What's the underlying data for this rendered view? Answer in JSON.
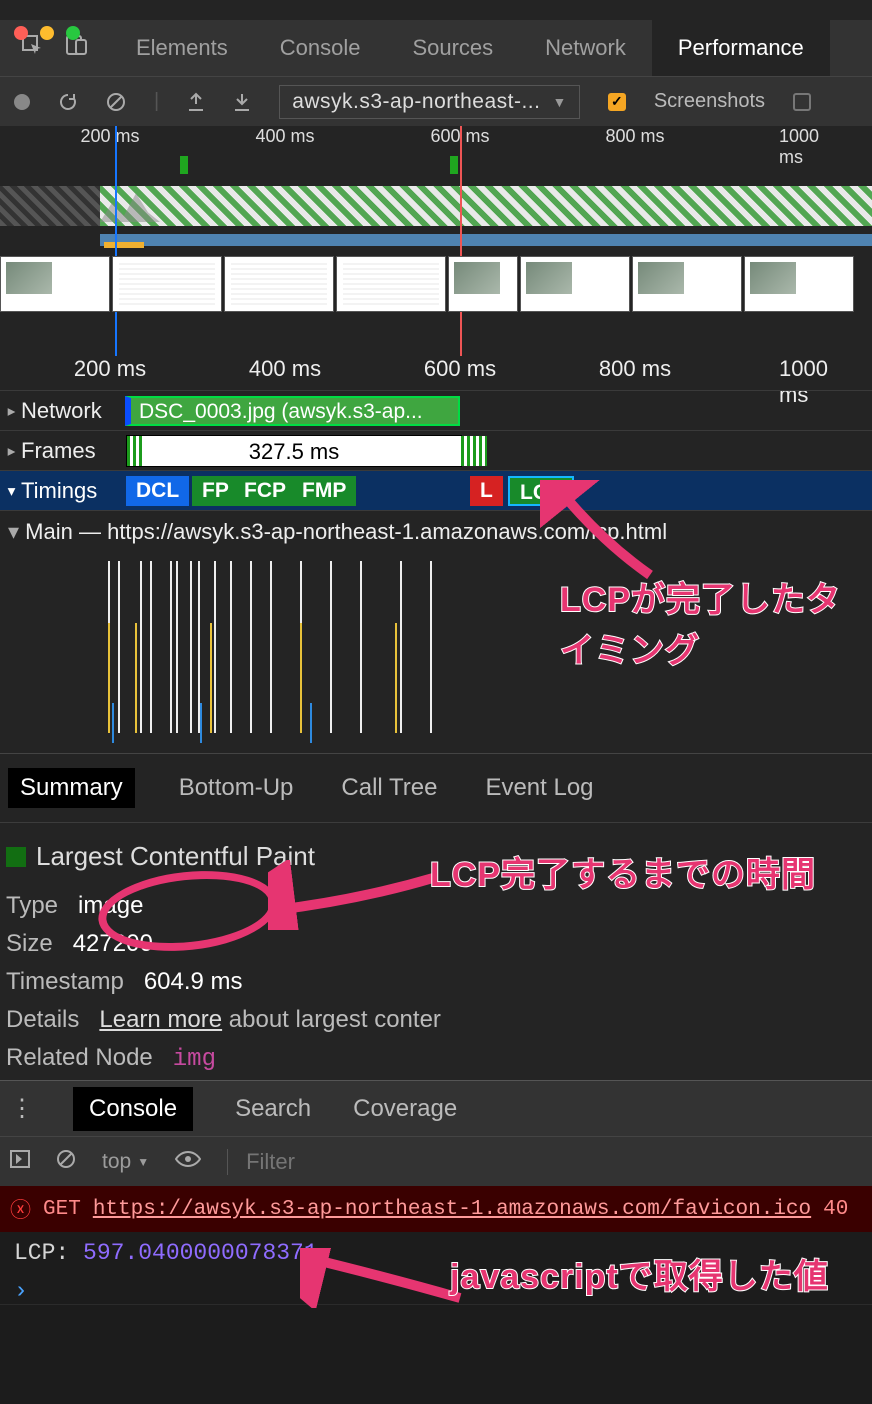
{
  "mainTabs": {
    "elements": "Elements",
    "console": "Console",
    "sources": "Sources",
    "network": "Network",
    "performance": "Performance"
  },
  "toolbar": {
    "urlSelect": "awsyk.s3-ap-northeast-...",
    "screenshots": "Screenshots"
  },
  "ticks": {
    "t200": "200 ms",
    "t400": "400 ms",
    "t600": "600 ms",
    "t800": "800 ms",
    "t1000": "1000 ms"
  },
  "tracks": {
    "network": "Network",
    "networkBar": "DSC_0003.jpg (awsyk.s3-ap...",
    "frames": "Frames",
    "framesBar": "327.5 ms",
    "timings": "Timings",
    "mainHeader": "Main — https://awsyk.s3-ap-northeast-1.amazonaws.com/lcp.html"
  },
  "timingChips": {
    "dcl": "DCL",
    "fp": "FP",
    "fcp": "FCP",
    "fmp": "FMP",
    "l": "L",
    "lcp": "LCP"
  },
  "detailTabs": {
    "summary": "Summary",
    "bottomUp": "Bottom-Up",
    "callTree": "Call Tree",
    "eventLog": "Event Log"
  },
  "detail": {
    "title": "Largest Contentful Paint",
    "typeLabel": "Type",
    "typeValue": "image",
    "sizeLabel": "Size",
    "sizeValue": "427200",
    "tsLabel": "Timestamp",
    "tsValue": "604.9 ms",
    "detailsLabel": "Details",
    "detailsLink": "Learn more",
    "detailsRest": " about largest conter",
    "relatedLabel": "Related Node",
    "relatedNode": "img"
  },
  "annotations": {
    "a1": "LCPが完了したタイミング",
    "a2": "LCP完了するまでの時間",
    "a3": "javascriptで取得した値"
  },
  "drawer": {
    "tabs": {
      "console": "Console",
      "search": "Search",
      "coverage": "Coverage"
    },
    "context": "top",
    "filterPlaceholder": "Filter",
    "err": {
      "method": "GET",
      "url": "https://awsyk.s3-ap-northeast-1.amazonaws.com/favicon.ico",
      "code": "40"
    },
    "log": {
      "label": "LCP: ",
      "value": "597.0400000078371"
    }
  }
}
